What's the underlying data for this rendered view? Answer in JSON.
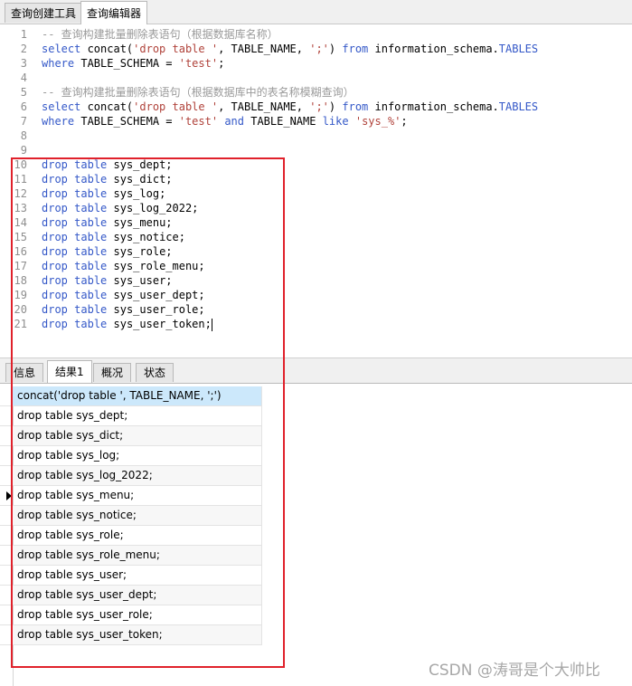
{
  "top_tabs": [
    {
      "label": "查询创建工具",
      "active": false
    },
    {
      "label": "查询编辑器",
      "active": true
    }
  ],
  "editor": {
    "lines": [
      {
        "n": "1",
        "tokens": [
          {
            "t": "-- 查询构建批量删除表语句（根据数据库名称）",
            "c": "cm"
          }
        ]
      },
      {
        "n": "2",
        "tokens": [
          {
            "t": "select",
            "c": "kw"
          },
          {
            "t": " concat(",
            "c": ""
          },
          {
            "t": "'drop table '",
            "c": "str"
          },
          {
            "t": ", TABLE_NAME, ",
            "c": ""
          },
          {
            "t": "';'",
            "c": "str"
          },
          {
            "t": ") ",
            "c": ""
          },
          {
            "t": "from",
            "c": "kw"
          },
          {
            "t": " information_schema.",
            "c": ""
          },
          {
            "t": "TABLES",
            "c": "kw"
          }
        ]
      },
      {
        "n": "3",
        "tokens": [
          {
            "t": "where",
            "c": "kw"
          },
          {
            "t": " TABLE_SCHEMA = ",
            "c": ""
          },
          {
            "t": "'test'",
            "c": "str"
          },
          {
            "t": ";",
            "c": ""
          }
        ]
      },
      {
        "n": "4",
        "tokens": []
      },
      {
        "n": "5",
        "tokens": [
          {
            "t": "-- 查询构建批量删除表语句（根据数据库中的表名称模糊查询）",
            "c": "cm"
          }
        ]
      },
      {
        "n": "6",
        "tokens": [
          {
            "t": "select",
            "c": "kw"
          },
          {
            "t": " concat(",
            "c": ""
          },
          {
            "t": "'drop table '",
            "c": "str"
          },
          {
            "t": ", TABLE_NAME, ",
            "c": ""
          },
          {
            "t": "';'",
            "c": "str"
          },
          {
            "t": ") ",
            "c": ""
          },
          {
            "t": "from",
            "c": "kw"
          },
          {
            "t": " information_schema.",
            "c": ""
          },
          {
            "t": "TABLES",
            "c": "kw"
          }
        ]
      },
      {
        "n": "7",
        "tokens": [
          {
            "t": "where",
            "c": "kw"
          },
          {
            "t": " TABLE_SCHEMA = ",
            "c": ""
          },
          {
            "t": "'test'",
            "c": "str"
          },
          {
            "t": " ",
            "c": ""
          },
          {
            "t": "and",
            "c": "kw"
          },
          {
            "t": " TABLE_NAME ",
            "c": ""
          },
          {
            "t": "like",
            "c": "kw"
          },
          {
            "t": " ",
            "c": ""
          },
          {
            "t": "'sys_%'",
            "c": "str"
          },
          {
            "t": ";",
            "c": ""
          }
        ]
      },
      {
        "n": "8",
        "tokens": []
      },
      {
        "n": "9",
        "tokens": []
      },
      {
        "n": "10",
        "tokens": [
          {
            "t": "drop",
            "c": "kw"
          },
          {
            "t": " ",
            "c": ""
          },
          {
            "t": "table",
            "c": "kw"
          },
          {
            "t": " sys_dept;",
            "c": ""
          }
        ]
      },
      {
        "n": "11",
        "tokens": [
          {
            "t": "drop",
            "c": "kw"
          },
          {
            "t": " ",
            "c": ""
          },
          {
            "t": "table",
            "c": "kw"
          },
          {
            "t": " sys_dict;",
            "c": ""
          }
        ]
      },
      {
        "n": "12",
        "tokens": [
          {
            "t": "drop",
            "c": "kw"
          },
          {
            "t": " ",
            "c": ""
          },
          {
            "t": "table",
            "c": "kw"
          },
          {
            "t": " sys_log;",
            "c": ""
          }
        ]
      },
      {
        "n": "13",
        "tokens": [
          {
            "t": "drop",
            "c": "kw"
          },
          {
            "t": " ",
            "c": ""
          },
          {
            "t": "table",
            "c": "kw"
          },
          {
            "t": " sys_log_2022;",
            "c": ""
          }
        ]
      },
      {
        "n": "14",
        "tokens": [
          {
            "t": "drop",
            "c": "kw"
          },
          {
            "t": " ",
            "c": ""
          },
          {
            "t": "table",
            "c": "kw"
          },
          {
            "t": " sys_menu;",
            "c": ""
          }
        ]
      },
      {
        "n": "15",
        "tokens": [
          {
            "t": "drop",
            "c": "kw"
          },
          {
            "t": " ",
            "c": ""
          },
          {
            "t": "table",
            "c": "kw"
          },
          {
            "t": " sys_notice;",
            "c": ""
          }
        ]
      },
      {
        "n": "16",
        "tokens": [
          {
            "t": "drop",
            "c": "kw"
          },
          {
            "t": " ",
            "c": ""
          },
          {
            "t": "table",
            "c": "kw"
          },
          {
            "t": " sys_role;",
            "c": ""
          }
        ]
      },
      {
        "n": "17",
        "tokens": [
          {
            "t": "drop",
            "c": "kw"
          },
          {
            "t": " ",
            "c": ""
          },
          {
            "t": "table",
            "c": "kw"
          },
          {
            "t": " sys_role_menu;",
            "c": ""
          }
        ]
      },
      {
        "n": "18",
        "tokens": [
          {
            "t": "drop",
            "c": "kw"
          },
          {
            "t": " ",
            "c": ""
          },
          {
            "t": "table",
            "c": "kw"
          },
          {
            "t": " sys_user;",
            "c": ""
          }
        ]
      },
      {
        "n": "19",
        "tokens": [
          {
            "t": "drop",
            "c": "kw"
          },
          {
            "t": " ",
            "c": ""
          },
          {
            "t": "table",
            "c": "kw"
          },
          {
            "t": " sys_user_dept;",
            "c": ""
          }
        ]
      },
      {
        "n": "20",
        "tokens": [
          {
            "t": "drop",
            "c": "kw"
          },
          {
            "t": " ",
            "c": ""
          },
          {
            "t": "table",
            "c": "kw"
          },
          {
            "t": " sys_user_role;",
            "c": ""
          }
        ]
      },
      {
        "n": "21",
        "tokens": [
          {
            "t": "drop",
            "c": "kw"
          },
          {
            "t": " ",
            "c": ""
          },
          {
            "t": "table",
            "c": "kw"
          },
          {
            "t": " sys_user_token;",
            "c": ""
          }
        ]
      }
    ]
  },
  "result_tabs": [
    {
      "label": "信息",
      "active": false
    },
    {
      "label": "结果1",
      "active": true
    },
    {
      "label": "概况",
      "active": false
    },
    {
      "label": "状态",
      "active": false
    }
  ],
  "grid": {
    "header": "concat('drop table ', TABLE_NAME, ';')",
    "rows": [
      "drop table sys_dept;",
      "drop table sys_dict;",
      "drop table sys_log;",
      "drop table sys_log_2022;",
      "drop table sys_menu;",
      "drop table sys_notice;",
      "drop table sys_role;",
      "drop table sys_role_menu;",
      "drop table sys_user;",
      "drop table sys_user_dept;",
      "drop table sys_user_role;",
      "drop table sys_user_token;"
    ],
    "current_row": 4
  },
  "watermark": "CSDN @涛哥是个大帅比",
  "colors": {
    "keyword": "#3458c8",
    "string": "#b0423a",
    "comment": "#9a9a9a",
    "highlight": "#e0212b",
    "header": "#cce8fb"
  }
}
